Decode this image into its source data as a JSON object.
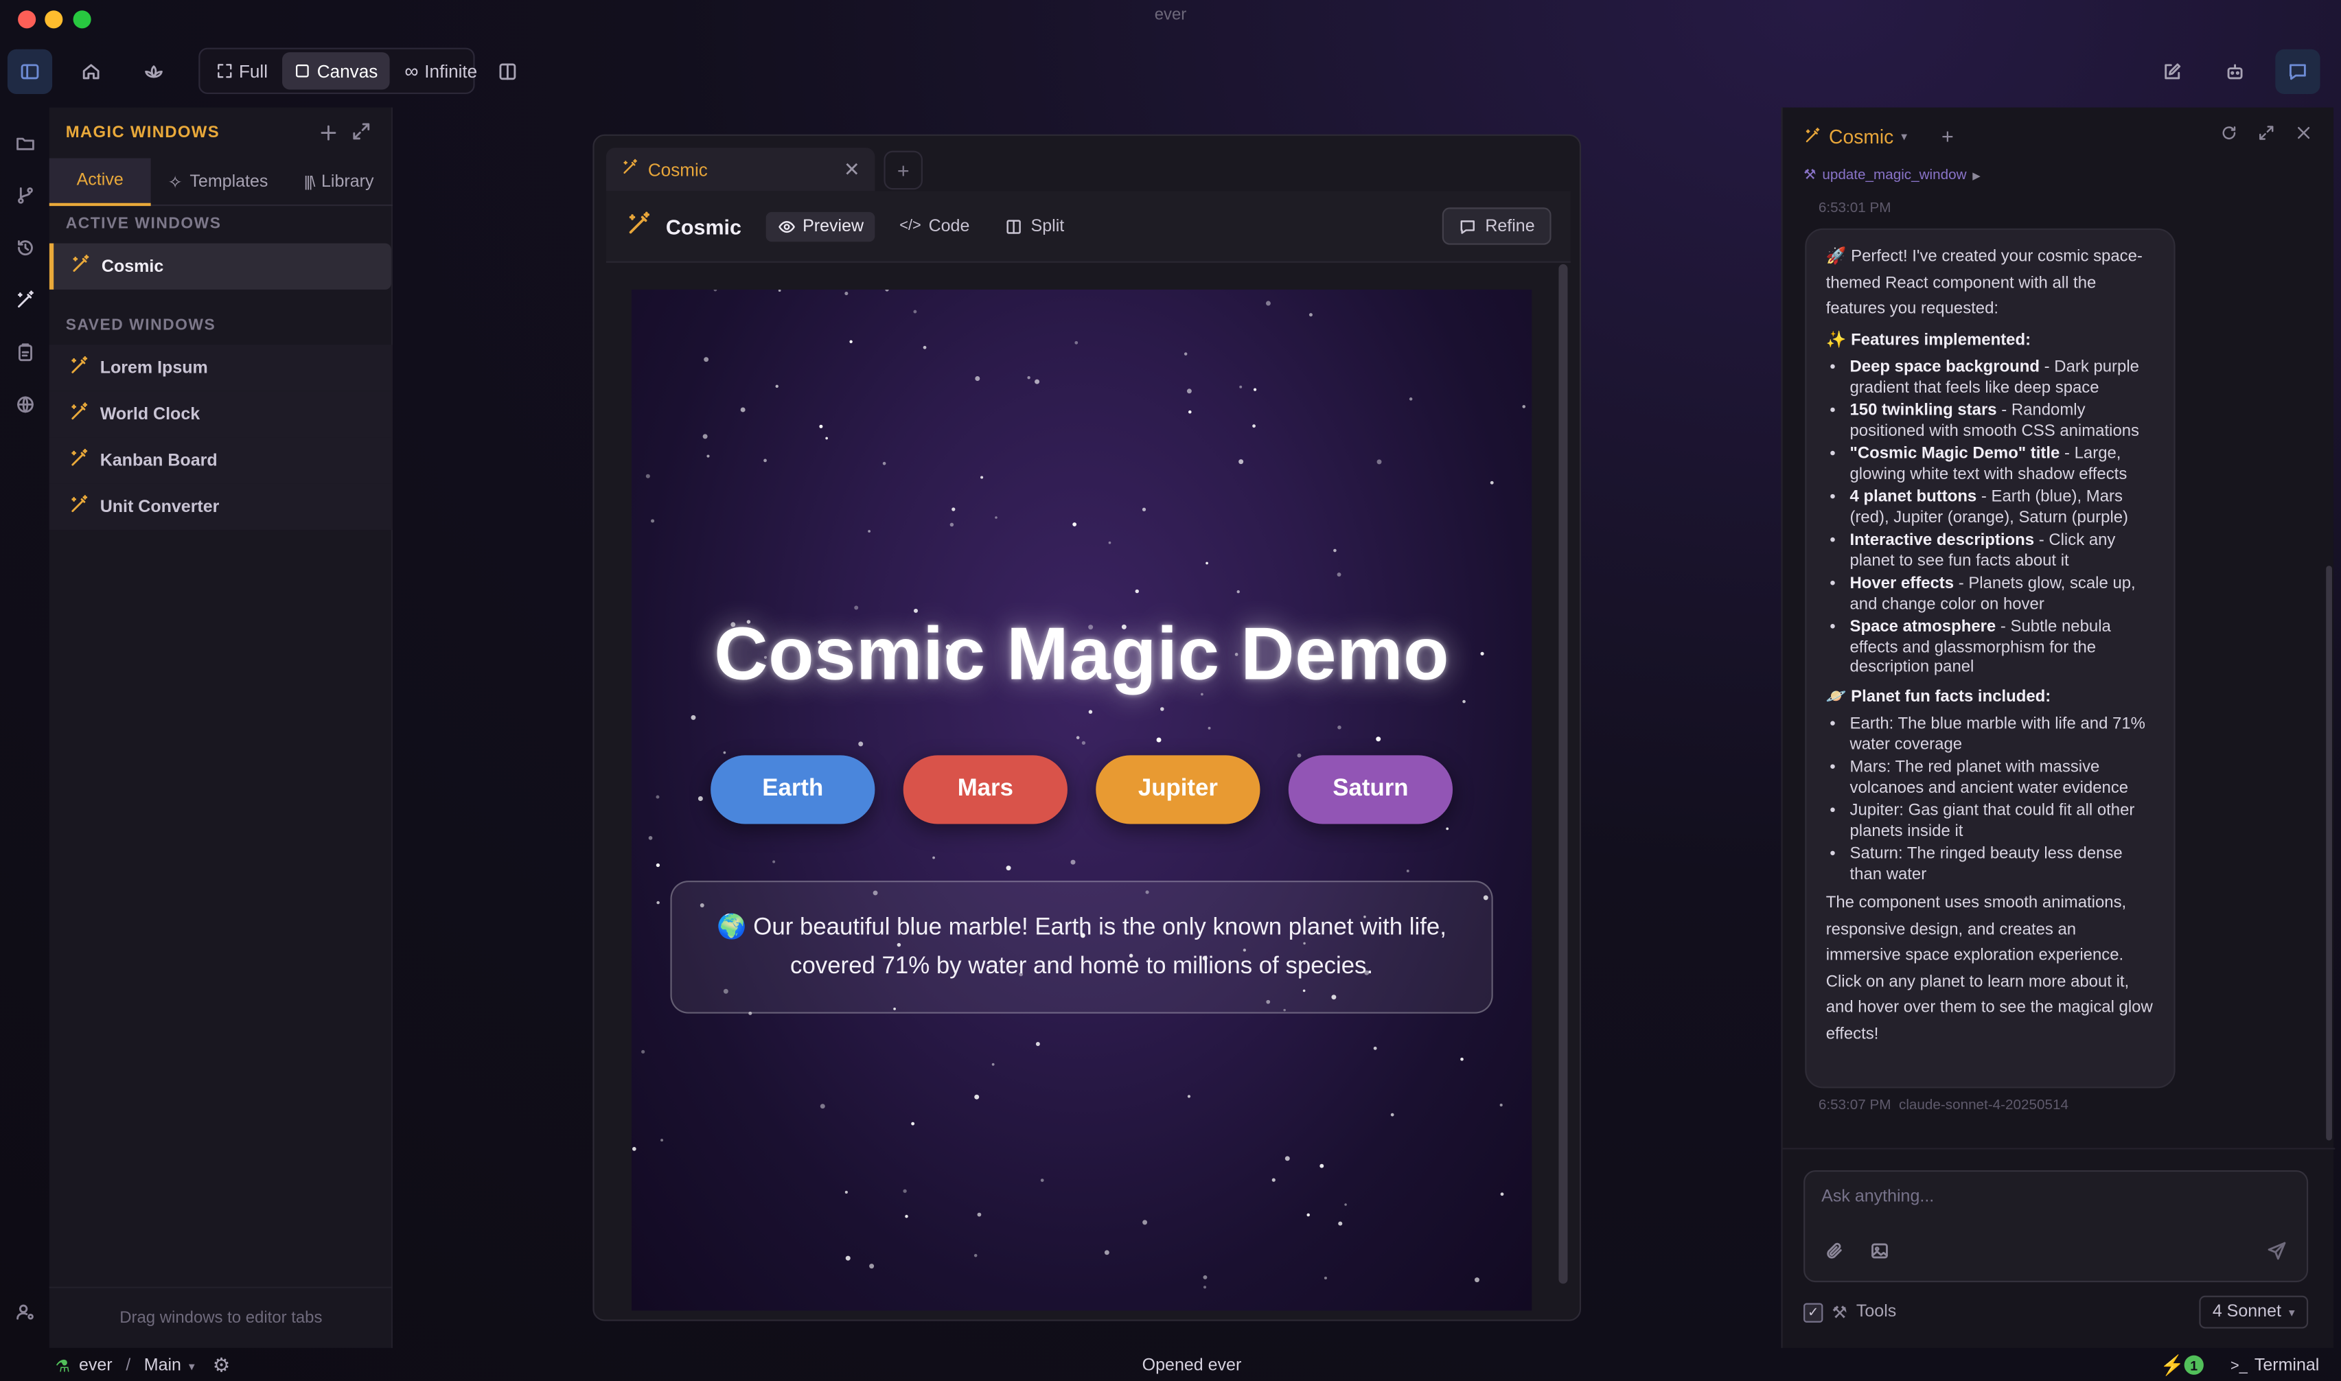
{
  "window": {
    "title": "ever"
  },
  "toolbar": {
    "modes": [
      {
        "label": "Full",
        "icon": "fullscreen-icon",
        "active": false
      },
      {
        "label": "Canvas",
        "icon": "square-icon",
        "active": true
      },
      {
        "label": "Infinite",
        "icon": "infinity-icon",
        "active": false
      }
    ]
  },
  "sidebar": {
    "header": "MAGIC WINDOWS",
    "tabs": [
      {
        "label": "Active",
        "active": true
      },
      {
        "label": "Templates",
        "active": false
      },
      {
        "label": "Library",
        "active": false
      }
    ],
    "active_section": "ACTIVE WINDOWS",
    "active_items": [
      "Cosmic"
    ],
    "saved_section": "SAVED WINDOWS",
    "saved_items": [
      "Lorem Ipsum",
      "World Clock",
      "Kanban Board",
      "Unit Converter"
    ],
    "footer": "Drag windows to editor tabs"
  },
  "editor": {
    "tab_label": "Cosmic",
    "title": "Cosmic",
    "views": [
      "Preview",
      "Code",
      "Split"
    ],
    "active_view": "Preview",
    "refine_label": "Refine"
  },
  "preview": {
    "heading": "Cosmic Magic Demo",
    "planets": [
      {
        "label": "Earth",
        "color": "#4a86dc"
      },
      {
        "label": "Mars",
        "color": "#d9534a"
      },
      {
        "label": "Jupiter",
        "color": "#e89a32"
      },
      {
        "label": "Saturn",
        "color": "#9255b5"
      }
    ],
    "description_emoji": "🌍",
    "description": "Our beautiful blue marble! Earth is the only known planet with life, covered 71% by water and home to millions of species."
  },
  "chat": {
    "title": "Cosmic",
    "tool_call": "update_magic_window",
    "time_top": "6:53:01 PM",
    "intro": "Perfect! I've created your cosmic space-themed React component with all the features you requested:",
    "features_heading": "Features implemented:",
    "features": [
      {
        "bold": "Deep space background",
        "text": " - Dark purple gradient that feels like deep space"
      },
      {
        "bold": "150 twinkling stars",
        "text": " - Randomly positioned with smooth CSS animations"
      },
      {
        "bold": "\"Cosmic Magic Demo\" title",
        "text": " - Large, glowing white text with shadow effects"
      },
      {
        "bold": "4 planet buttons",
        "text": " - Earth (blue), Mars (red), Jupiter (orange), Saturn (purple)"
      },
      {
        "bold": "Interactive descriptions",
        "text": " - Click any planet to see fun facts about it"
      },
      {
        "bold": "Hover effects",
        "text": " - Planets glow, scale up, and change color on hover"
      },
      {
        "bold": "Space atmosphere",
        "text": " - Subtle nebula effects and glassmorphism for the description panel"
      }
    ],
    "facts_heading": "Planet fun facts included:",
    "facts": [
      "Earth: The blue marble with life and 71% water coverage",
      "Mars: The red planet with massive volcanoes and ancient water evidence",
      "Jupiter: Gas giant that could fit all other planets inside it",
      "Saturn: The ringed beauty less dense than water"
    ],
    "outro": "The component uses smooth animations, responsive design, and creates an immersive space exploration experience. Click on any planet to learn more about it, and hover over them to see the magical glow effects!",
    "time_bottom": "6:53:07 PM",
    "model_id": "claude-sonnet-4-20250514",
    "input_placeholder": "Ask anything...",
    "tools_label": "Tools",
    "model_label": "4 Sonnet"
  },
  "statusbar": {
    "project": "ever",
    "separator": "/",
    "branch": "Main",
    "center": "Opened ever",
    "badge_count": "1",
    "terminal": "Terminal"
  },
  "colors": {
    "accent": "#e9a93a",
    "tool_link": "#8a74c9"
  }
}
